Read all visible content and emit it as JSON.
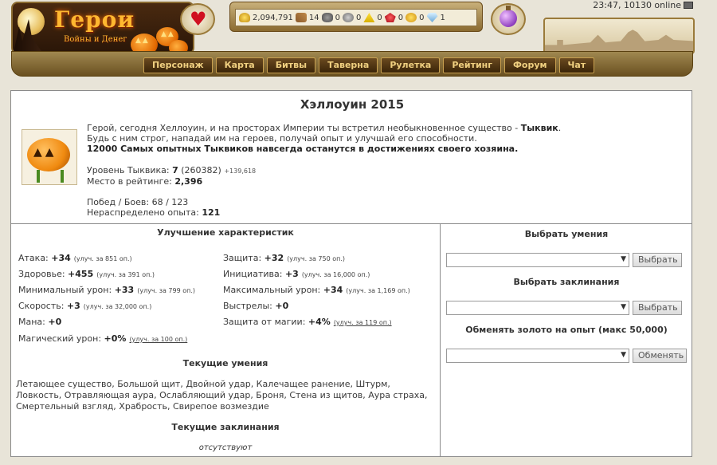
{
  "header": {
    "logo_text": "Герои",
    "logo_subtitle": "Войны и Денег",
    "resources": [
      {
        "icon": "gold-icon",
        "value": "2,094,791"
      },
      {
        "icon": "wood-icon",
        "value": "14"
      },
      {
        "icon": "ore-icon",
        "value": "0"
      },
      {
        "icon": "mercury-icon",
        "value": "0"
      },
      {
        "icon": "sulfur-icon",
        "value": "0"
      },
      {
        "icon": "crystal-icon",
        "value": "0"
      },
      {
        "icon": "gems-icon",
        "value": "0"
      },
      {
        "icon": "diamond-icon",
        "value": "1"
      }
    ],
    "server_info": "23:47, 10130 online",
    "nav": [
      "Персонаж",
      "Карта",
      "Битвы",
      "Таверна",
      "Рулетка",
      "Рейтинг",
      "Форум",
      "Чат"
    ]
  },
  "event": {
    "title": "Хэллоуин 2015",
    "line1_prefix": "Герой, сегодня Хеллоуин, и на просторах Империи ты встретил необыкновенное существо - ",
    "line1_bold": "Тыквик",
    "line1_suffix": ".",
    "line2": "Будь с ним строг, нападай им на героев, получай опыт и улучшай его способности.",
    "line3": "12000 Самых опытных Тыквиков навсегда останутся в достижениях своего хозяина.",
    "level_label": "Уровень Тыквика: ",
    "level_value": "7",
    "level_exp": "(260382)",
    "level_gain": "+139,618",
    "rank_label": "Место в рейтинге: ",
    "rank_value": "2,396",
    "wins_label": "Побед / Боев: ",
    "wins_value": "68 / 123",
    "unspent_label": "Нераспределено опыта: ",
    "unspent_value": "121"
  },
  "stats_section": {
    "title": "Улучшение характеристик",
    "left": [
      {
        "label": "Атака: ",
        "value": "+34",
        "upgrade": "(улуч. за 851 оп.)"
      },
      {
        "label": "Здоровье: ",
        "value": "+455",
        "upgrade": "(улуч. за 391 оп.)"
      },
      {
        "label": "Минимальный урон: ",
        "value": "+33",
        "upgrade": "(улуч. за 799 оп.)"
      },
      {
        "label": "Скорость: ",
        "value": "+3",
        "upgrade": "(улуч. за 32,000 оп.)"
      },
      {
        "label": "Мана: ",
        "value": "+0",
        "upgrade": ""
      },
      {
        "label": "Магический урон: ",
        "value": "+0%",
        "upgrade": "(улуч. за 100 оп.)"
      }
    ],
    "right": [
      {
        "label": "Защита: ",
        "value": "+32",
        "upgrade": "(улуч. за 750 оп.)"
      },
      {
        "label": "Инициатива: ",
        "value": "+3",
        "upgrade": "(улуч. за 16,000 оп.)"
      },
      {
        "label": "Максимальный урон: ",
        "value": "+34",
        "upgrade": "(улуч. за 1,169 оп.)"
      },
      {
        "label": "Выстрелы: ",
        "value": "+0",
        "upgrade": ""
      },
      {
        "label": "Защита от магии: ",
        "value": "+4%",
        "upgrade": "(улуч. за 119 оп.)"
      }
    ]
  },
  "skills": {
    "title": "Текущие умения",
    "text": "Летающее существо, Большой щит, Двойной удар, Калечащее ранение, Штурм, Ловкость, Отравляющая аура, Ослабляющий удар, Броня, Стена из щитов, Аура страха, Смертельный взгляд, Храбрость, Свирепое возмездие"
  },
  "spells": {
    "title": "Текущие заклинания",
    "text": "отсутствуют"
  },
  "right_panel": {
    "choose_skills_title": "Выбрать умения",
    "choose_skills_button": "Выбрать",
    "choose_spells_title": "Выбрать заклинания",
    "choose_spells_button": "Выбрать",
    "exchange_title": "Обменять золото на опыт (макс 50,000)",
    "exchange_button": "Обменять"
  }
}
